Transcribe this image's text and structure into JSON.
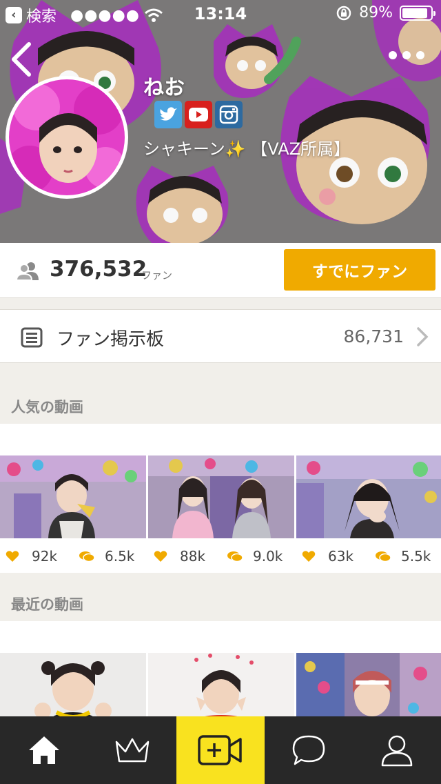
{
  "status_bar": {
    "back_app": "検索",
    "signal": "●●●●●",
    "time": "13:14",
    "battery": "89%",
    "battery_level": 0.89
  },
  "profile": {
    "name": "ねお",
    "bio": "シャキーン✨ 【VAZ所属】",
    "social_links": [
      "twitter-icon",
      "youtube-icon",
      "instagram-icon"
    ]
  },
  "fans": {
    "count": "376,532",
    "unit": "ファン",
    "button_label": "すでにファン"
  },
  "board": {
    "label": "ファン掲示板",
    "count": "86,731"
  },
  "popular": {
    "title": "人気の動画",
    "videos": [
      {
        "likes": "92k",
        "comments": "6.5k"
      },
      {
        "likes": "88k",
        "comments": "9.0k"
      },
      {
        "likes": "63k",
        "comments": "5.5k"
      }
    ]
  },
  "recent": {
    "title": "最近の動画"
  },
  "tab_bar": {
    "tabs": [
      "home-icon",
      "crown-icon",
      "video-record-icon",
      "chat-icon",
      "profile-icon"
    ],
    "active": "video-record-icon"
  },
  "colors": {
    "accent": "#f0aa00",
    "record_tab": "#f9e21f",
    "tab_bar": "#282828",
    "icon_gold": "#f0aa00",
    "background": "#f1efea"
  }
}
